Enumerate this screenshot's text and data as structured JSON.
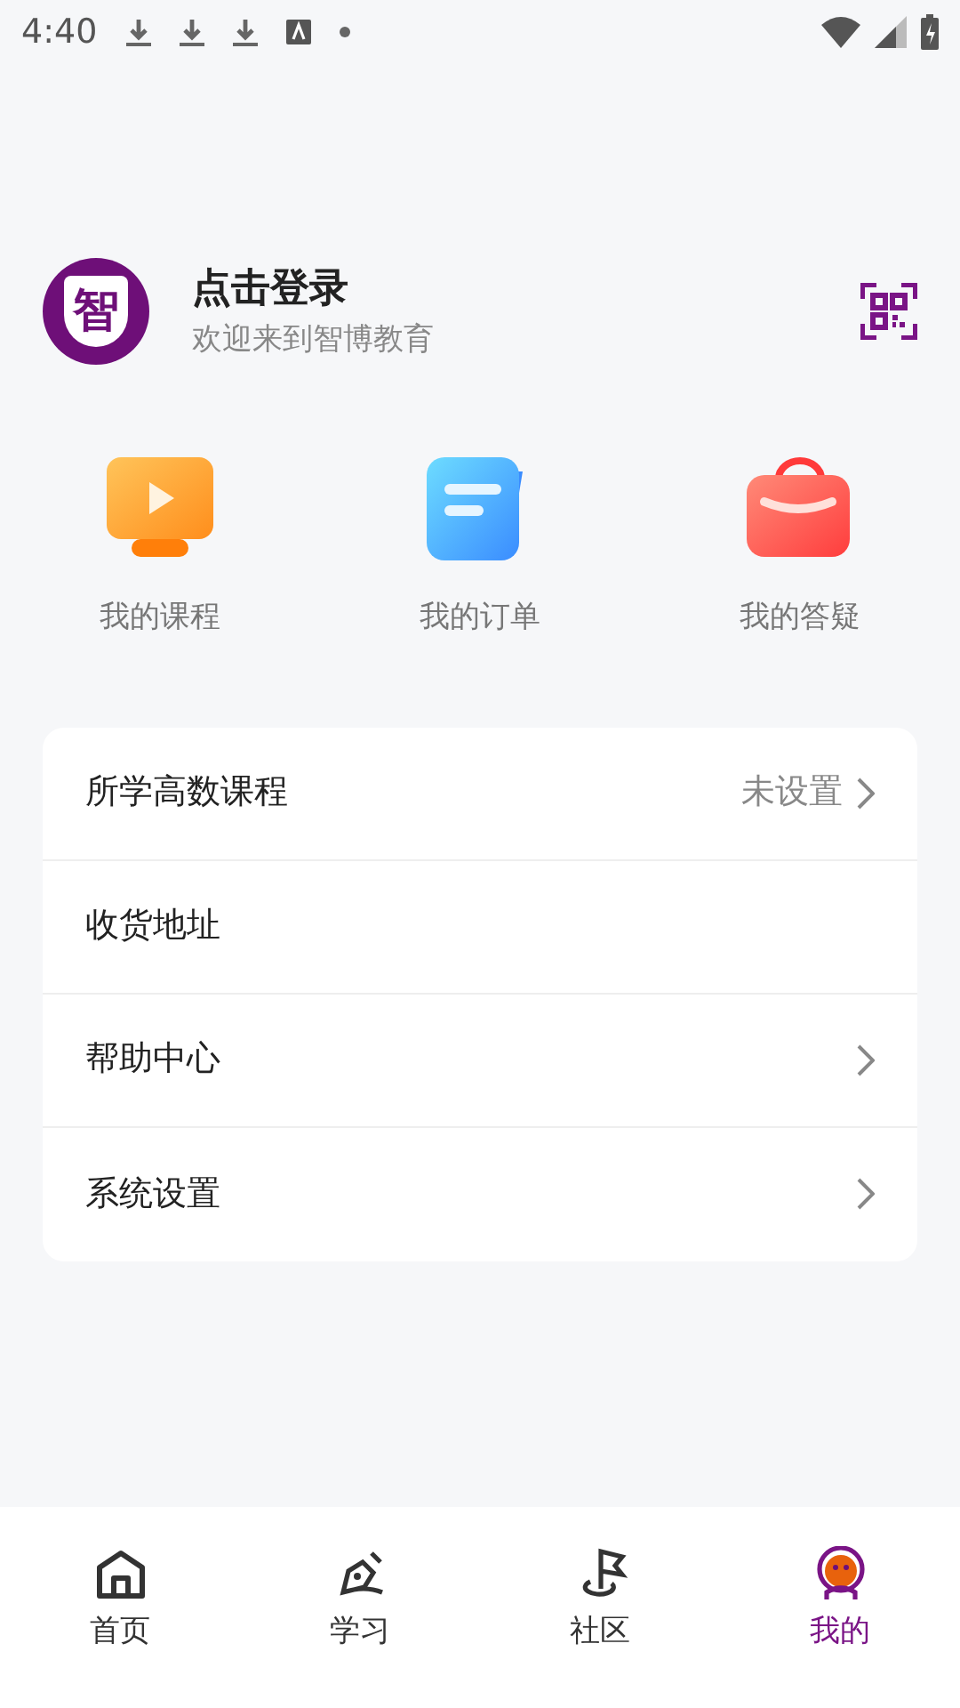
{
  "status_bar": {
    "time": "4:40"
  },
  "profile": {
    "logo_text": "智",
    "title": "点击登录",
    "subtitle": "欢迎来到智博教育"
  },
  "shortcuts": [
    {
      "kind": "course",
      "label": "我的课程"
    },
    {
      "kind": "order",
      "label": "我的订单"
    },
    {
      "kind": "qa",
      "label": "我的答疑"
    }
  ],
  "menu": [
    {
      "label": "所学高数课程",
      "value": "未设置",
      "chevron": true
    },
    {
      "label": "收货地址",
      "chevron": false
    },
    {
      "label": "帮助中心",
      "chevron": true
    },
    {
      "label": "系统设置",
      "chevron": true
    }
  ],
  "tab_bar": [
    {
      "kind": "home",
      "label": "首页",
      "selected": false
    },
    {
      "kind": "study",
      "label": "学习",
      "selected": false
    },
    {
      "kind": "community",
      "label": "社区",
      "selected": false
    },
    {
      "kind": "me",
      "label": "我的",
      "selected": true
    }
  ]
}
